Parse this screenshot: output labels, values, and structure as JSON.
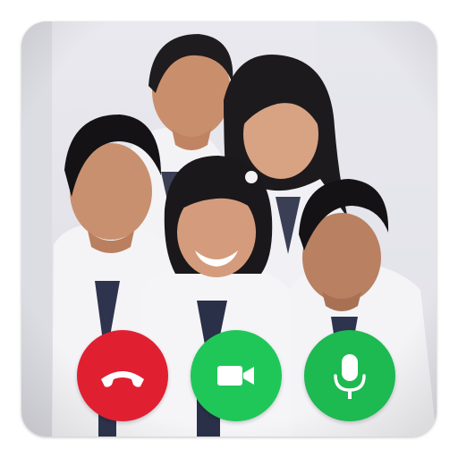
{
  "call_screen": {
    "background_photo": {
      "subject_count": 5
    },
    "controls": [
      {
        "id": "end-call",
        "icon": "phone-hangup-icon",
        "color": "#e02030"
      },
      {
        "id": "video",
        "icon": "video-camera-icon",
        "color": "#1fc759"
      },
      {
        "id": "mic",
        "icon": "microphone-icon",
        "color": "#1db951"
      }
    ]
  }
}
